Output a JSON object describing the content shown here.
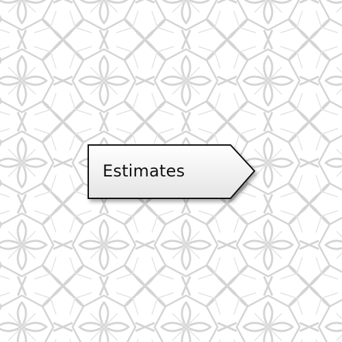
{
  "background": {
    "pattern": "grey-floral-star-lattice",
    "base_color": "#ffffff",
    "line_color": "#d6d6d6"
  },
  "tag": {
    "label": "Estimates",
    "shape": "arrow-tag-pointing-right",
    "fill_top": "#ffffff",
    "fill_bottom": "#e4e4e4",
    "border_color": "#111111"
  }
}
